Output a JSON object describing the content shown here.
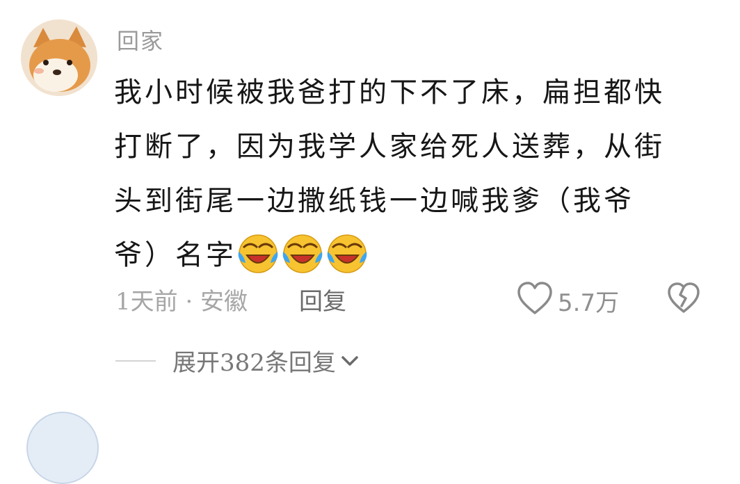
{
  "comment": {
    "username": "回家",
    "lines": [
      "我小时候被我爸打的下不了床，扁担都快",
      "打断了，因为我学人家给死人送葬，从街",
      "头到街尾一边撒纸钱一边喊我爹（我爷",
      "爷）名字"
    ],
    "emojis": [
      "laughing-crying-emoji",
      "laughing-crying-emoji",
      "laughing-crying-emoji"
    ],
    "time_location": "1天前 · 安徽",
    "reply_label": "回复",
    "like_count": "5.7万",
    "expand_label": "展开382条回复"
  },
  "icons": {
    "like": "heart-outline-icon",
    "dislike": "broken-heart-icon",
    "expand": "chevron-down-icon"
  },
  "colors": {
    "text": "#161616",
    "secondary": "#9a9a9a",
    "emoji_face": "#f7c330"
  }
}
